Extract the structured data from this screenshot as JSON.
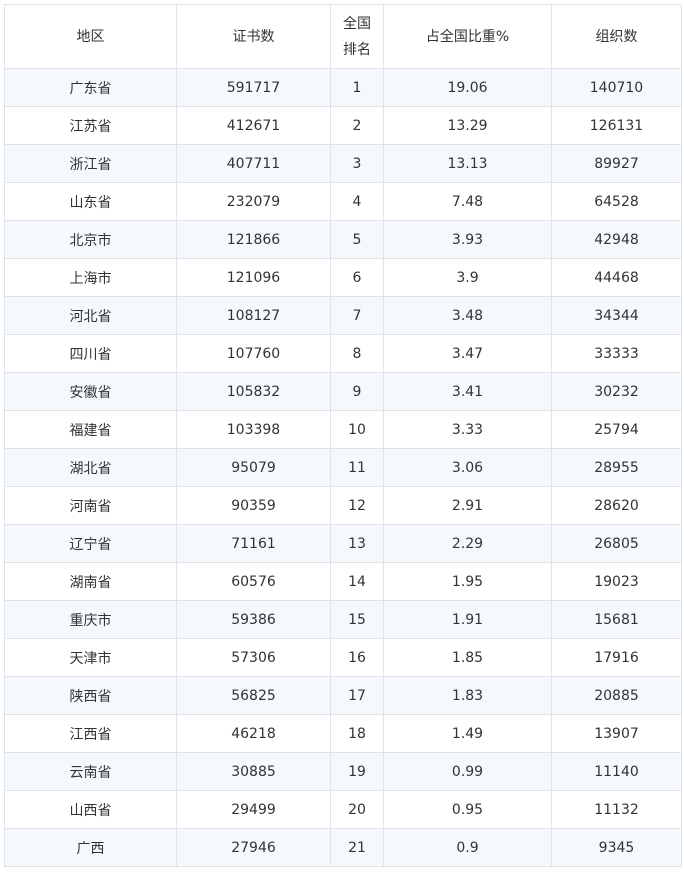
{
  "table": {
    "headers": {
      "region": "地区",
      "certificates": "证书数",
      "rank_line1": "全国",
      "rank_line2": "排名",
      "share": "占全国比重%",
      "organizations": "组织数"
    },
    "rows": [
      {
        "region": "广东省",
        "certificates": "591717",
        "rank": "1",
        "share": "19.06",
        "organizations": "140710"
      },
      {
        "region": "江苏省",
        "certificates": "412671",
        "rank": "2",
        "share": "13.29",
        "organizations": "126131"
      },
      {
        "region": "浙江省",
        "certificates": "407711",
        "rank": "3",
        "share": "13.13",
        "organizations": "89927"
      },
      {
        "region": "山东省",
        "certificates": "232079",
        "rank": "4",
        "share": "7.48",
        "organizations": "64528"
      },
      {
        "region": "北京市",
        "certificates": "121866",
        "rank": "5",
        "share": "3.93",
        "organizations": "42948"
      },
      {
        "region": "上海市",
        "certificates": "121096",
        "rank": "6",
        "share": "3.9",
        "organizations": "44468"
      },
      {
        "region": "河北省",
        "certificates": "108127",
        "rank": "7",
        "share": "3.48",
        "organizations": "34344"
      },
      {
        "region": "四川省",
        "certificates": "107760",
        "rank": "8",
        "share": "3.47",
        "organizations": "33333"
      },
      {
        "region": "安徽省",
        "certificates": "105832",
        "rank": "9",
        "share": "3.41",
        "organizations": "30232"
      },
      {
        "region": "福建省",
        "certificates": "103398",
        "rank": "10",
        "share": "3.33",
        "organizations": "25794"
      },
      {
        "region": "湖北省",
        "certificates": "95079",
        "rank": "11",
        "share": "3.06",
        "organizations": "28955"
      },
      {
        "region": "河南省",
        "certificates": "90359",
        "rank": "12",
        "share": "2.91",
        "organizations": "28620"
      },
      {
        "region": "辽宁省",
        "certificates": "71161",
        "rank": "13",
        "share": "2.29",
        "organizations": "26805"
      },
      {
        "region": "湖南省",
        "certificates": "60576",
        "rank": "14",
        "share": "1.95",
        "organizations": "19023"
      },
      {
        "region": "重庆市",
        "certificates": "59386",
        "rank": "15",
        "share": "1.91",
        "organizations": "15681"
      },
      {
        "region": "天津市",
        "certificates": "57306",
        "rank": "16",
        "share": "1.85",
        "organizations": "17916"
      },
      {
        "region": "陕西省",
        "certificates": "56825",
        "rank": "17",
        "share": "1.83",
        "organizations": "20885"
      },
      {
        "region": "江西省",
        "certificates": "46218",
        "rank": "18",
        "share": "1.49",
        "organizations": "13907"
      },
      {
        "region": "云南省",
        "certificates": "30885",
        "rank": "19",
        "share": "0.99",
        "organizations": "11140"
      },
      {
        "region": "山西省",
        "certificates": "29499",
        "rank": "20",
        "share": "0.95",
        "organizations": "11132"
      },
      {
        "region": "广西",
        "certificates": "27946",
        "rank": "21",
        "share": "0.9",
        "organizations": "9345"
      }
    ]
  },
  "colors": {
    "stripe": "#f5f9fd",
    "border": "#dfe3e8",
    "text": "#333333"
  }
}
